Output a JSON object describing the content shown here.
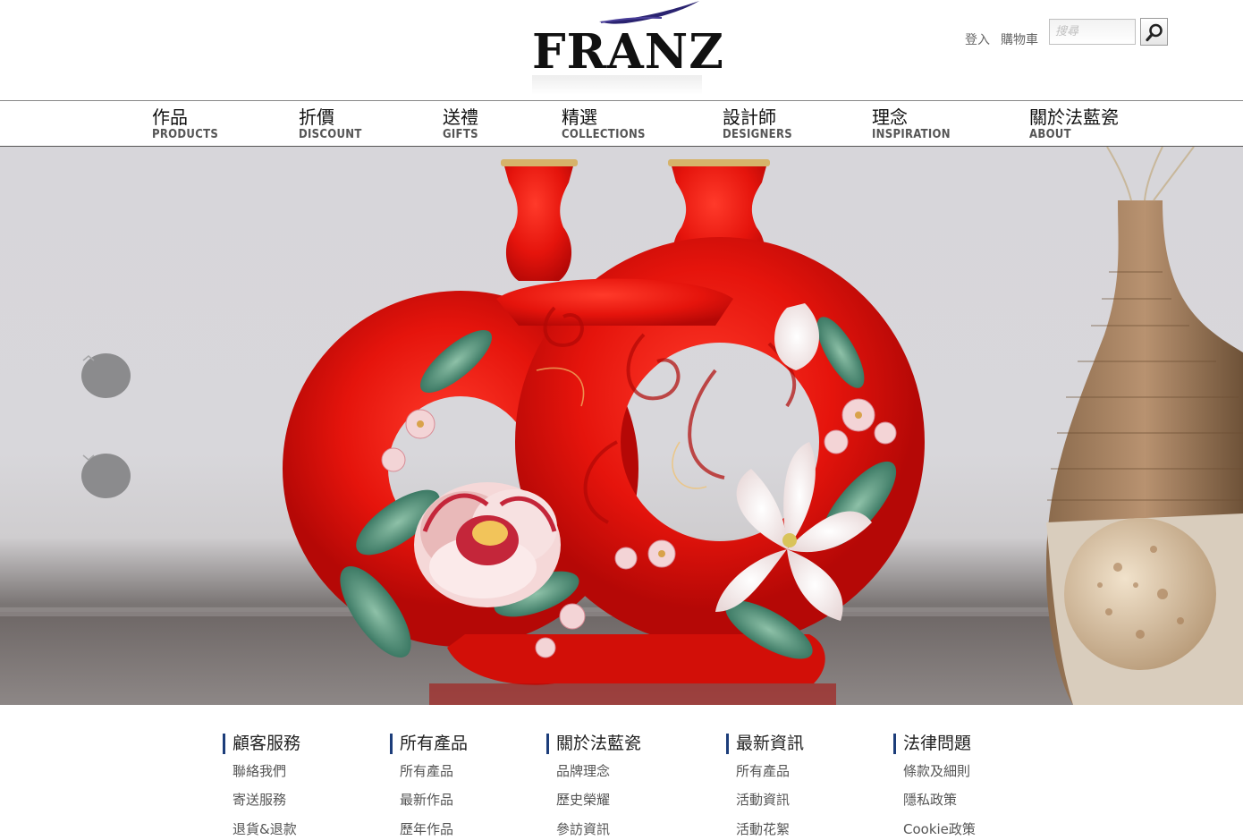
{
  "header": {
    "logo_text": "FRANZ",
    "login_label": "登入",
    "cart_label": "購物車",
    "search_placeholder": "搜尋"
  },
  "nav": {
    "items": [
      {
        "zh": "作品",
        "en": "PRODUCTS"
      },
      {
        "zh": "折價",
        "en": "DISCOUNT"
      },
      {
        "zh": "送禮",
        "en": "GIFTS"
      },
      {
        "zh": "精選",
        "en": "COLLECTIONS"
      },
      {
        "zh": "設計師",
        "en": "DESIGNERS"
      },
      {
        "zh": "理念",
        "en": "INSPIRATION"
      },
      {
        "zh": "關於法藍瓷",
        "en": "ABOUT"
      }
    ]
  },
  "hero": {
    "prev_icon": "chevron-up-icon",
    "next_icon": "chevron-down-icon",
    "colors": {
      "vase_red": "#e8140d",
      "background": "#d7d6da"
    }
  },
  "footer": {
    "accent_color": "#1c3d7a",
    "columns": [
      {
        "title": "顧客服務",
        "links": [
          "聯絡我們",
          "寄送服務",
          "退貨&退款"
        ]
      },
      {
        "title": "所有產品",
        "links": [
          "所有產品",
          "最新作品",
          "歷年作品"
        ]
      },
      {
        "title": "關於法藍瓷",
        "links": [
          "品牌理念",
          "歷史榮耀",
          "參訪資訊"
        ]
      },
      {
        "title": "最新資訊",
        "links": [
          "所有產品",
          "活動資訊",
          "活動花絮"
        ]
      },
      {
        "title": "法律問題",
        "links": [
          "條款及細則",
          "隱私政策",
          "Cookie政策"
        ]
      }
    ]
  }
}
